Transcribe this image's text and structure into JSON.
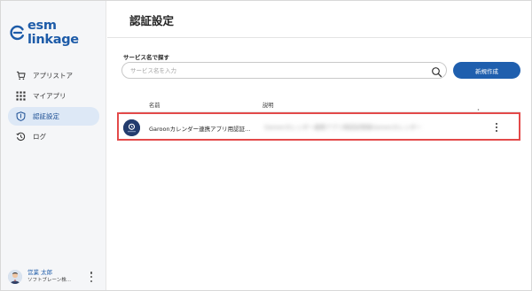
{
  "app": {
    "logo_text": "esm linkage"
  },
  "sidebar": {
    "items": [
      {
        "label": "アプリストア",
        "icon": "cart-icon",
        "active": false
      },
      {
        "label": "マイアプリ",
        "icon": "grid-icon",
        "active": false
      },
      {
        "label": "認証設定",
        "icon": "shield-icon",
        "active": true
      },
      {
        "label": "ログ",
        "icon": "history-icon",
        "active": false
      }
    ]
  },
  "user": {
    "name": "営業 太郎",
    "org": "ソフトブレーン株..."
  },
  "header": {
    "title": "認証設定"
  },
  "search": {
    "label": "サービス名で探す",
    "placeholder": "サービス名を入力",
    "value": ""
  },
  "actions": {
    "create_label": "新規作成"
  },
  "table": {
    "columns": [
      "名前",
      "説明"
    ],
    "rows": [
      {
        "name": "Garoonカレンダー連携アプリ用認証...",
        "description": "Garoonカレンダー連携アプリ用認証情報Garoonカレンダー"
      }
    ]
  },
  "colors": {
    "brand": "#1d5ba8",
    "primary_button": "#1f5fae",
    "highlight_border": "#e34a4a",
    "active_nav_bg": "#dde8f6"
  }
}
